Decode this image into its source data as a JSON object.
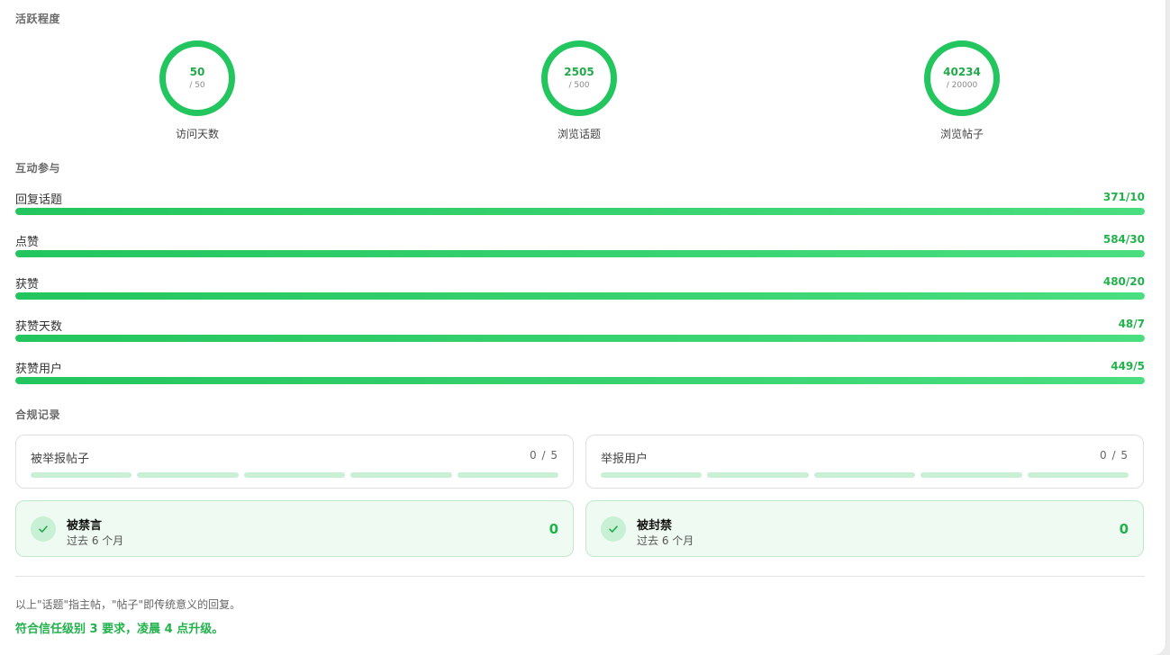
{
  "activity": {
    "title": "活跃程度",
    "rings": [
      {
        "label": "访问天数",
        "value": "50",
        "total": "/ 50",
        "progress": 1.0
      },
      {
        "label": "浏览话题",
        "value": "2505",
        "total": "/ 500",
        "progress": 1.0
      },
      {
        "label": "浏览帖子",
        "value": "40234",
        "total": "/ 20000",
        "progress": 1.0
      }
    ]
  },
  "engagement": {
    "title": "互动参与",
    "rows": [
      {
        "label": "回复话题",
        "value": "371/10",
        "progress": 1.0
      },
      {
        "label": "点赞",
        "value": "584/30",
        "progress": 1.0
      },
      {
        "label": "获赞",
        "value": "480/20",
        "progress": 1.0
      },
      {
        "label": "获赞天数",
        "value": "48/7",
        "progress": 1.0
      },
      {
        "label": "获赞用户",
        "value": "449/5",
        "progress": 1.0
      }
    ]
  },
  "compliance": {
    "title": "合规记录",
    "reported_posts": {
      "label": "被举报帖子",
      "value": "0 / 5"
    },
    "reported_users": {
      "label": "举报用户",
      "value": "0 / 5"
    },
    "silenced": {
      "title": "被禁言",
      "subtitle": "过去 6 个月",
      "value": "0"
    },
    "suspended": {
      "title": "被封禁",
      "subtitle": "过去 6 个月",
      "value": "0"
    }
  },
  "footer": {
    "note": "以上\"话题\"指主帖，\"帖子\"即传统意义的回复。",
    "result": "符合信任级别 3 要求，凌晨 4 点升级。"
  },
  "colors": {
    "accent": "#22c55e",
    "accent_text": "#22b24c",
    "light_track": "#c9efd5",
    "success_bg": "#effbf2"
  }
}
